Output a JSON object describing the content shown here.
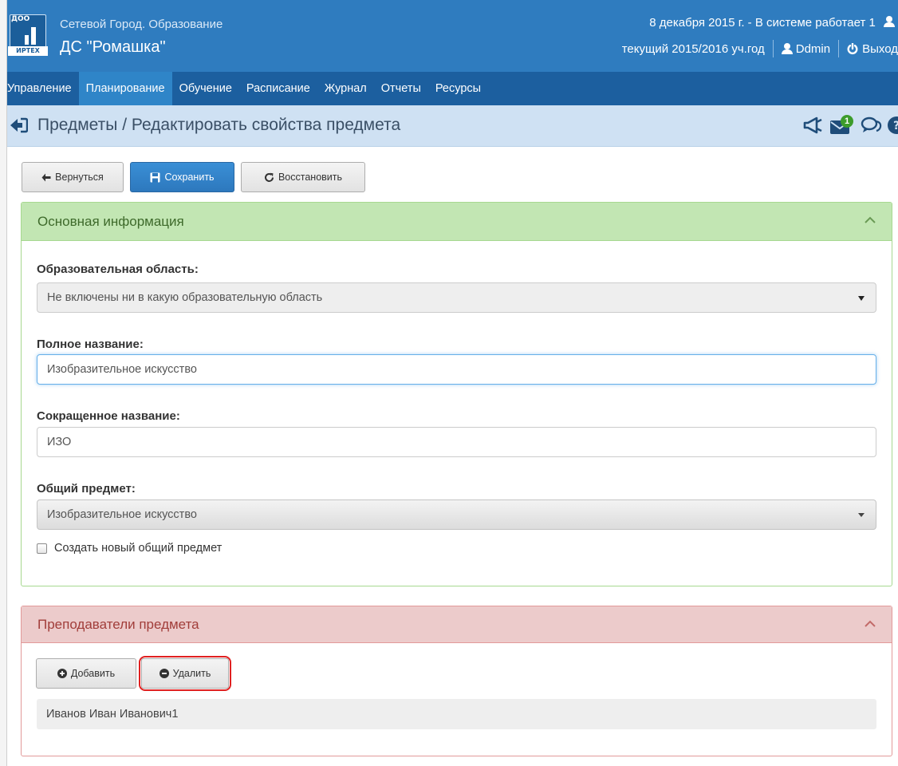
{
  "header": {
    "logo_top_text": "ДОО",
    "logo_brand": "ИРТЕХ",
    "app_title": "Сетевой Город. Образование",
    "org_name": "ДС \"Ромашка\"",
    "status_line": "8 декабря 2015 г. - В системе работает 1",
    "year_text": "текущий 2015/2016 уч.год",
    "user_name": "Ddmin",
    "logout_label": "Выход"
  },
  "nav": {
    "items": [
      {
        "label": "Управление"
      },
      {
        "label": "Планирование",
        "active": true
      },
      {
        "label": "Обучение"
      },
      {
        "label": "Расписание"
      },
      {
        "label": "Журнал"
      },
      {
        "label": "Отчеты"
      },
      {
        "label": "Ресурсы"
      }
    ]
  },
  "breadcrumb": {
    "text": "Предметы / Редактировать свойства предмета",
    "mail_badge": "1"
  },
  "toolbar": {
    "back_label": "Вернуться",
    "save_label": "Сохранить",
    "restore_label": "Восстановить"
  },
  "main_info": {
    "title": "Основная информация",
    "area_label": "Образовательная область:",
    "area_value": "Не включены ни в какую образовательную область",
    "full_name_label": "Полное название:",
    "full_name_value": "Изобразительное искусство",
    "short_name_label": "Сокращенное название:",
    "short_name_value": "ИЗО",
    "common_subject_label": "Общий предмет:",
    "common_subject_value": "Изобразительное искусство",
    "create_new_label": "Создать новый общий предмет",
    "create_new_checked": false
  },
  "teachers": {
    "title": "Преподаватели предмета",
    "add_label": "Добавить",
    "delete_label": "Удалить",
    "list": [
      "Иванов Иван Иванович1"
    ]
  },
  "colors": {
    "header_blue": "#2f7cbf",
    "nav_blue": "#1c5f9f",
    "nav_active": "#2f85c8",
    "panel_green": "#c2e6b3",
    "panel_red": "#eccbcb",
    "highlight_red": "#e02020"
  }
}
